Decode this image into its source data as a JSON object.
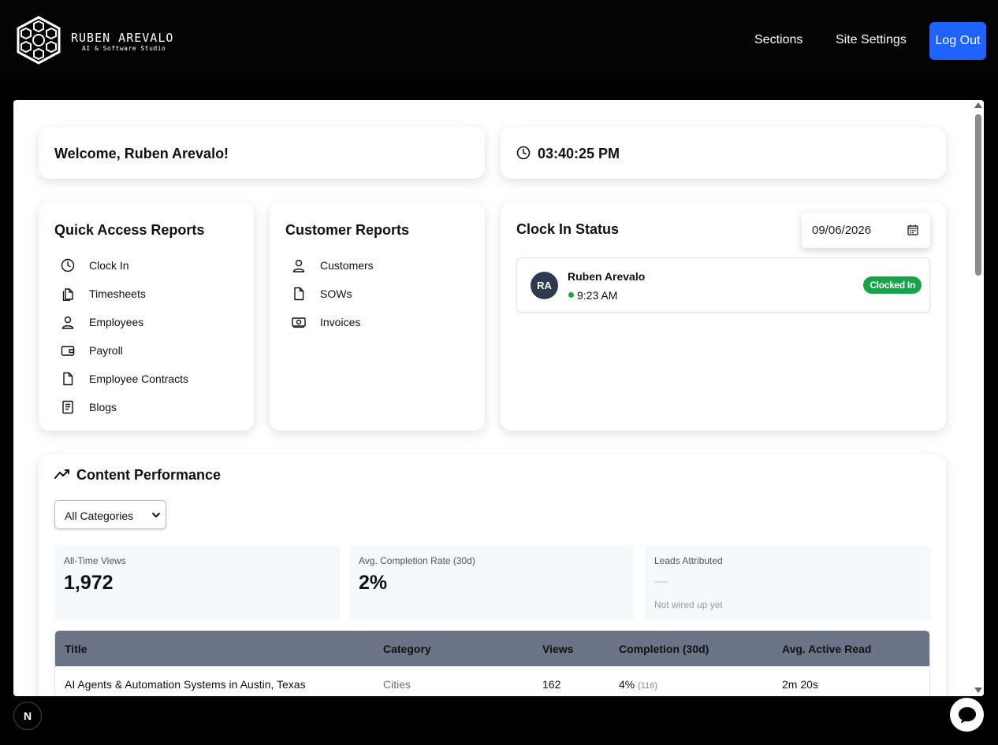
{
  "header": {
    "brand_name": "RUBEN AREVALO",
    "brand_tagline": "AI & Software Studio",
    "nav": [
      "Sections",
      "Site Settings"
    ],
    "logout_label": "Log Out",
    "accent": "#1e63ff"
  },
  "welcome": {
    "text": "Welcome, Ruben Arevalo!"
  },
  "clock": {
    "time": "03:40:25 PM"
  },
  "quick_access": {
    "title": "Quick Access Reports",
    "items": [
      {
        "label": "Clock In",
        "icon": "clock-icon"
      },
      {
        "label": "Timesheets",
        "icon": "documents-icon"
      },
      {
        "label": "Employees",
        "icon": "user-icon"
      },
      {
        "label": "Payroll",
        "icon": "wallet-icon"
      },
      {
        "label": "Employee Contracts",
        "icon": "document-icon"
      },
      {
        "label": "Blogs",
        "icon": "blog-icon"
      }
    ]
  },
  "customer_reports": {
    "title": "Customer Reports",
    "items": [
      {
        "label": "Customers",
        "icon": "user-icon"
      },
      {
        "label": "SOWs",
        "icon": "document-icon"
      },
      {
        "label": "Invoices",
        "icon": "banknote-icon"
      }
    ]
  },
  "clock_status": {
    "title": "Clock In Status",
    "date": "09/06/2026",
    "entries": [
      {
        "initials": "RA",
        "name": "Ruben Arevalo",
        "time": "9:23 AM",
        "status": "Clocked In",
        "status_color": "#16a34a"
      }
    ]
  },
  "content_performance": {
    "title": "Content Performance",
    "filter_selected": "All Categories",
    "stats": [
      {
        "label": "All-Time Views",
        "value": "1,972"
      },
      {
        "label": "Avg. Completion Rate (30d)",
        "value": "2%"
      },
      {
        "label": "Leads Attributed",
        "value": "",
        "note": "Not wired up yet"
      }
    ],
    "table": {
      "headers": [
        "Title",
        "Category",
        "Views",
        "Completion (30d)",
        "Avg. Active Read"
      ],
      "rows": [
        {
          "title": "AI Agents & Automation Systems in Austin, Texas",
          "category": "Cities",
          "views": "162",
          "completion": "4%",
          "completion_count": "(116)",
          "avg_read": "2m 20s"
        }
      ]
    }
  },
  "floating": {
    "n_badge": "N"
  }
}
